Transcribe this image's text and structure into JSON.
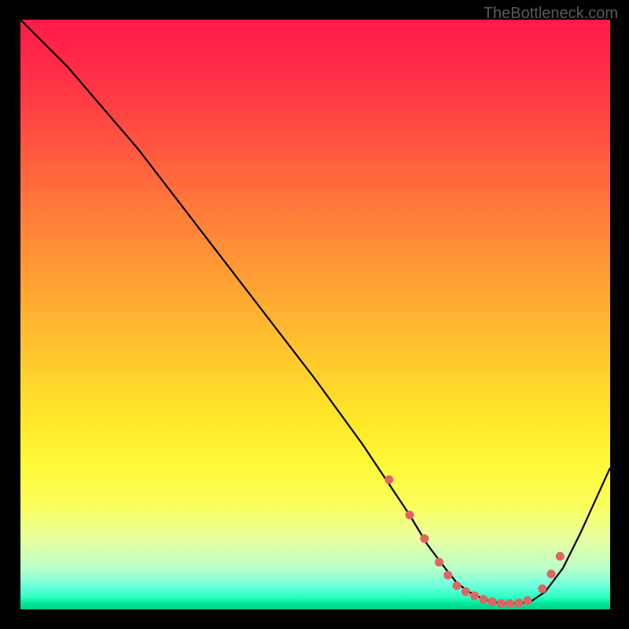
{
  "watermark": "TheBottleneck.com",
  "chart_data": {
    "type": "line",
    "title": "",
    "xlabel": "",
    "ylabel": "",
    "xlim": [
      0,
      100
    ],
    "ylim": [
      0,
      100
    ],
    "series": [
      {
        "name": "curve",
        "x": [
          0,
          8,
          20,
          30,
          40,
          50,
          58,
          62,
          66,
          69,
          72,
          74,
          76,
          78,
          80,
          82,
          84,
          86.5,
          89,
          92,
          95,
          100
        ],
        "y": [
          100,
          92,
          78,
          65,
          52,
          39,
          28,
          22,
          16,
          11,
          7,
          4.5,
          3,
          2,
          1.3,
          1,
          1,
          1.3,
          3,
          7,
          13,
          24
        ]
      }
    ],
    "markers": {
      "name": "salmon-dots",
      "color": "#e06464",
      "x": [
        62.5,
        66,
        68.5,
        71,
        72.5,
        74,
        75.5,
        77,
        78.5,
        80,
        81.5,
        83,
        84.5,
        86,
        88.5,
        90,
        91.5
      ],
      "y": [
        22,
        16,
        12,
        8,
        5.8,
        4,
        3,
        2.3,
        1.7,
        1.3,
        1,
        1,
        1.1,
        1.5,
        3.5,
        6,
        9
      ]
    },
    "gradient_stops": [
      {
        "pos": 0,
        "color": "#ff1a4a"
      },
      {
        "pos": 20,
        "color": "#ff5140"
      },
      {
        "pos": 45,
        "color": "#ffa233"
      },
      {
        "pos": 68,
        "color": "#ffe828"
      },
      {
        "pos": 88,
        "color": "#e9ffa0"
      },
      {
        "pos": 98,
        "color": "#2affc2"
      },
      {
        "pos": 100,
        "color": "#00d084"
      }
    ]
  }
}
